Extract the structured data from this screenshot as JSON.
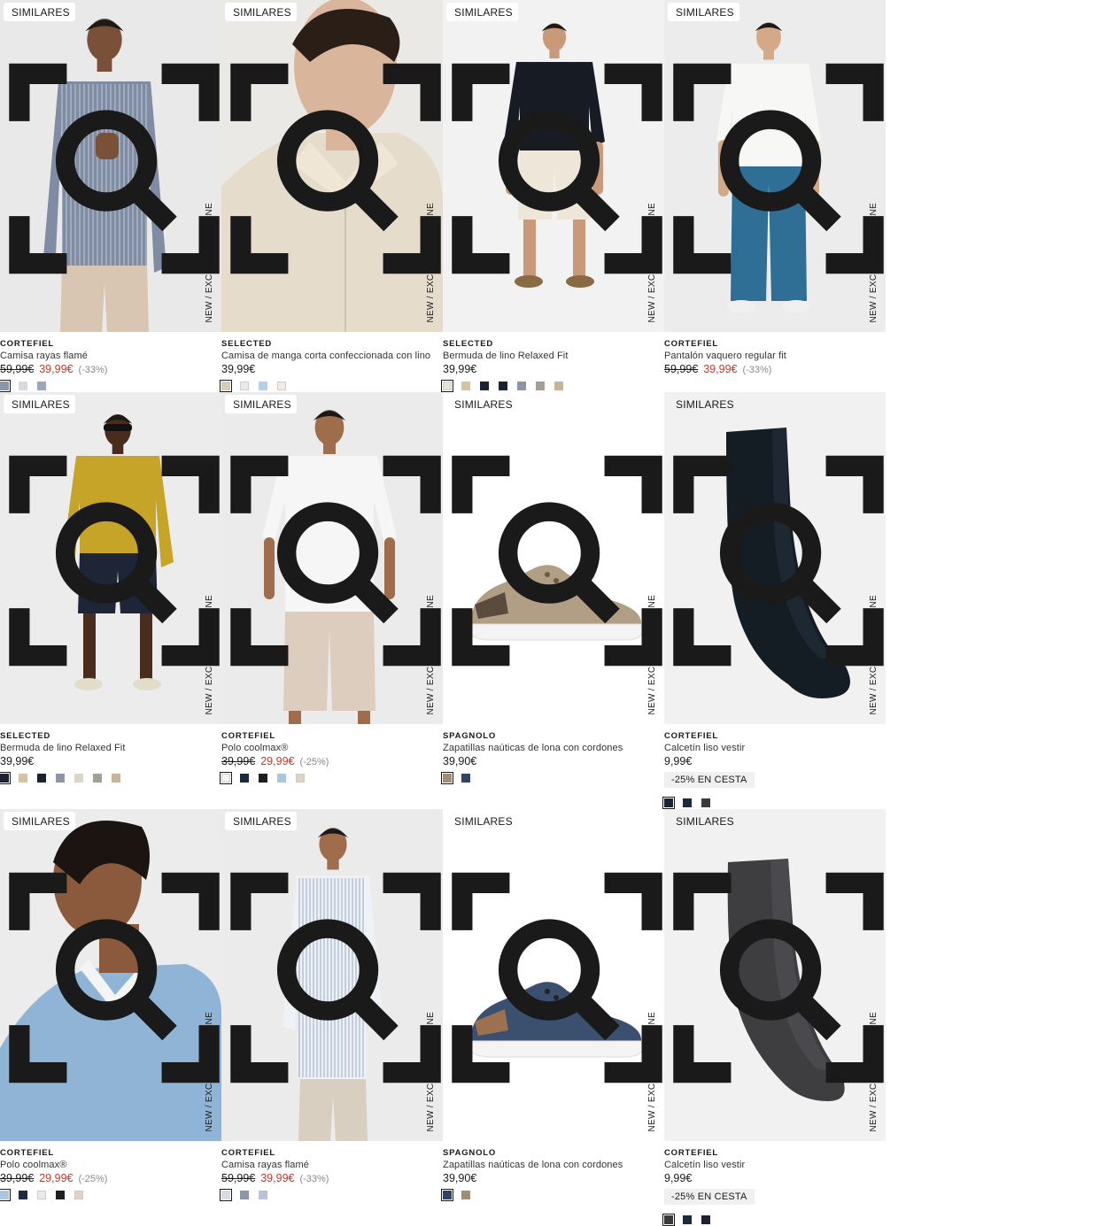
{
  "labels": {
    "similar": "SIMILARES",
    "tag": "NEW  /  EXCLUSIVO ONLINE"
  },
  "products": [
    {
      "brand": "CORTEFIEL",
      "name": "Camisa rayas flamé",
      "old": "59,99€",
      "price": "39,99€",
      "discount": "(-33%)",
      "promo": "",
      "swatches": [
        "#8d96a8",
        "#d6dae2",
        "#9aa5c0"
      ],
      "image": "man-striped-shirt"
    },
    {
      "brand": "SELECTED",
      "name": "Camisa de manga corta confeccionada con lino",
      "old": "",
      "price": "39,99€",
      "discount": "",
      "promo": "",
      "swatches": [
        "#d8cbb5",
        "#eaeaea",
        "#b8cfe8",
        "#f1ece3"
      ],
      "image": "linen-shirt-closeup"
    },
    {
      "brand": "SELECTED",
      "name": "Bermuda de lino Relaxed Fit",
      "old": "",
      "price": "39,99€",
      "discount": "",
      "promo": "",
      "swatches": [
        "#e8e2d4",
        "#d4c4a6",
        "#1b2333",
        "#1e2230",
        "#8f95a6",
        "#a2a096",
        "#c8b497"
      ],
      "image": "man-linen-shorts"
    },
    {
      "brand": "CORTEFIEL",
      "name": "Pantalón vaquero regular fit",
      "old": "59,99€",
      "price": "39,99€",
      "discount": "(-33%)",
      "promo": "",
      "swatches": [],
      "image": "man-jeans"
    },
    {
      "brand": "SELECTED",
      "name": "Bermuda de lino Relaxed Fit",
      "old": "",
      "price": "39,99€",
      "discount": "",
      "promo": "",
      "swatches": [
        "#1e2230",
        "#d4c4a6",
        "#1b2333",
        "#8f95a6",
        "#ddd6c3",
        "#a2a096",
        "#c8b497"
      ],
      "image": "man-yellow-sweater"
    },
    {
      "brand": "CORTEFIEL",
      "name": "Polo coolmax®",
      "old": "39,99€",
      "price": "29,99€",
      "discount": "(-25%)",
      "promo": "",
      "swatches": [
        "#f2f2f2",
        "#1b2a44",
        "#1e1e1e",
        "#a9c6e3",
        "#e2d3c0"
      ],
      "image": "man-white-polo"
    },
    {
      "brand": "SPAGNOLO",
      "name": "Zapatillas naúticas de lona con cordones",
      "old": "",
      "price": "39,90€",
      "discount": "",
      "promo": "",
      "swatches": [
        "#a08d74",
        "#2f4466"
      ],
      "image": "beige-boat-shoe"
    },
    {
      "brand": "CORTEFIEL",
      "name": "Calcetín liso vestir",
      "old": "",
      "price": "9,99€",
      "discount": "",
      "promo": "-25% EN CESTA",
      "swatches": [
        "#1b2333",
        "#1c2a40",
        "#3a3a3a"
      ],
      "image": "navy-sock"
    },
    {
      "brand": "CORTEFIEL",
      "name": "Polo coolmax®",
      "old": "39,99€",
      "price": "29,99€",
      "discount": "(-25%)",
      "promo": "",
      "swatches": [
        "#a9c6e3",
        "#1b2a44",
        "#eaeaea",
        "#1e1e1e",
        "#e2d3c0"
      ],
      "image": "man-blue-polo"
    },
    {
      "brand": "CORTEFIEL",
      "name": "Camisa rayas flamé",
      "old": "59,99€",
      "price": "39,99€",
      "discount": "(-33%)",
      "promo": "",
      "swatches": [
        "#d6dae2",
        "#8d96a8",
        "#b8c2d8"
      ],
      "image": "man-white-striped-shirt"
    },
    {
      "brand": "SPAGNOLO",
      "name": "Zapatillas naúticas de lona con cordones",
      "old": "",
      "price": "39,90€",
      "discount": "",
      "promo": "",
      "swatches": [
        "#2f4466",
        "#a08d74"
      ],
      "image": "navy-boat-shoe"
    },
    {
      "brand": "CORTEFIEL",
      "name": "Calcetín liso vestir",
      "old": "",
      "price": "9,99€",
      "discount": "",
      "promo": "-25% EN CESTA",
      "swatches": [
        "#3a3a3a",
        "#1c2a40",
        "#1b2333"
      ],
      "image": "grey-sock"
    }
  ]
}
